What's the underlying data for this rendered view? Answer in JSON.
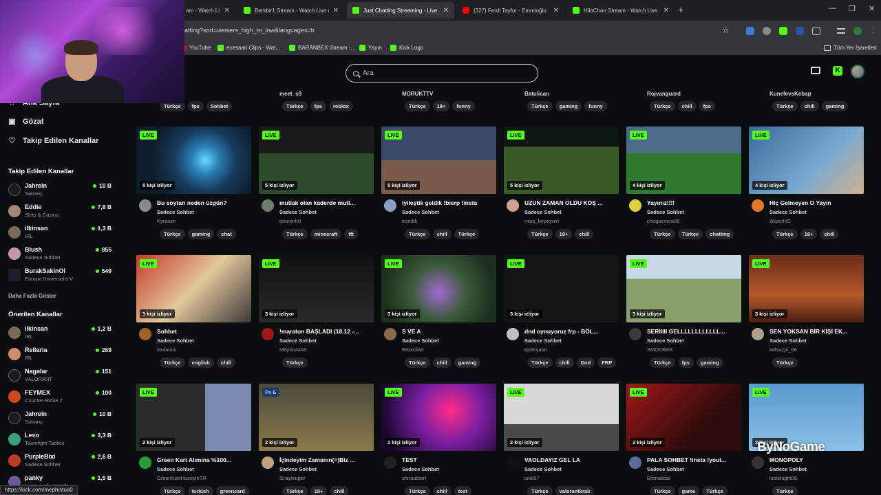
{
  "browser": {
    "tabs": [
      {
        "title": "am - Watch Li",
        "icon": "kick-favicon"
      },
      {
        "title": "Berkbir1 Stream - Watch Live o",
        "icon": "kick-favicon"
      },
      {
        "title": "Just Chatting Streaming - Live S",
        "icon": "kick-favicon",
        "active": true
      },
      {
        "title": "(327) Ferdi Tayfur - Emmioğlu",
        "icon": "youtube-favicon"
      },
      {
        "title": "HiloChan Stream - Watch Live o",
        "icon": "kick-favicon"
      }
    ],
    "url": "atting?sort=viewers_high_to_low&languages=tr",
    "bookmarks": [
      {
        "label": "YouTube",
        "icon": "youtube-icon"
      },
      {
        "label": "ecesaari Clips - Wat...",
        "icon": "kick-icon"
      },
      {
        "label": "BARANBEX Stream -...",
        "icon": "kick-icon"
      },
      {
        "label": "Yayın",
        "icon": "kick-icon"
      },
      {
        "label": "Kick Logo",
        "icon": "kick-icon"
      }
    ],
    "all_bookmarks": "Tüm Yer İşaretleri",
    "status_url": "https://kick.com/mephistoa0"
  },
  "header": {
    "search_placeholder": "Ara"
  },
  "sidebar": {
    "nav": [
      {
        "label": "Ana Sayfa",
        "icon": "home-icon"
      },
      {
        "label": "Gözat",
        "icon": "browse-icon"
      },
      {
        "label": "Takip Edilen Kanallar",
        "icon": "heart-icon"
      }
    ],
    "followed_title": "Takip Edilen Kanallar",
    "followed": [
      {
        "name": "Jahrein",
        "category": "Satranç",
        "viewers": "10 B"
      },
      {
        "name": "Eddie",
        "category": "Slots & Casino",
        "viewers": "7,8 B"
      },
      {
        "name": "ilkinsan",
        "category": "IRL",
        "viewers": "1,3 B"
      },
      {
        "name": "Blush",
        "category": "Sadece Sohbet",
        "viewers": "855"
      },
      {
        "name": "BurakSakinOl",
        "category": "Europa Universalis V",
        "viewers": "549"
      }
    ],
    "show_more": "Daha Fazla Göster",
    "recommended_title": "Önerilen Kanallar",
    "recommended": [
      {
        "name": "ilkinsan",
        "category": "IRL",
        "viewers": "1,2 B"
      },
      {
        "name": "Rellaria",
        "category": "IRL",
        "viewers": "269"
      },
      {
        "name": "Nagalar",
        "category": "VALORANT",
        "viewers": "151"
      },
      {
        "name": "FEYMEX",
        "category": "Counter-Strike 2",
        "viewers": "100"
      },
      {
        "name": "Jahrein",
        "category": "Satranç",
        "viewers": "10 B"
      },
      {
        "name": "Levo",
        "category": "Teamfight Tactics",
        "viewers": "3,3 B"
      },
      {
        "name": "PurpleBixi",
        "category": "Sadece Sohbet",
        "viewers": "2,6 B"
      },
      {
        "name": "panky",
        "category": "League of Legends",
        "viewers": "1,5 B"
      }
    ]
  },
  "top_row": [
    {
      "name": "s_ZONE",
      "tags": [
        "Türkçe",
        "fps",
        "Sohbet"
      ]
    },
    {
      "name": "meet_s9",
      "tags": [
        "Türkçe",
        "fps",
        "roblox"
      ]
    },
    {
      "name": "MORUKTTV",
      "tags": [
        "Türkçe",
        "18+",
        "funny"
      ]
    },
    {
      "name": "Batulican",
      "tags": [
        "Türkçe",
        "gaming",
        "funny"
      ]
    },
    {
      "name": "Rojvanguard",
      "tags": [
        "Türkçe",
        "chill",
        "fps"
      ]
    },
    {
      "name": "KunefevsKebap",
      "tags": [
        "Türkçe",
        "chill",
        "gaming"
      ]
    }
  ],
  "streams": [
    {
      "title": "Bu soytarı neden üzgün?",
      "category": "Sadece Sohbet",
      "channel": "Kyraaen",
      "viewers": "5 kişi izliyor",
      "live": "LIVE",
      "tags": [
        "Türkçe",
        "gaming",
        "chat"
      ],
      "thumb": "th-game1",
      "avatar": "#8a8a8a"
    },
    {
      "title": "mutlak olan kaderde mutl...",
      "category": "Sadece Sohbet",
      "channel": "omerinh0",
      "viewers": "5 kişi izliyor",
      "live": "LIVE",
      "tags": [
        "Türkçe",
        "minecraft",
        "tft"
      ],
      "thumb": "th-football",
      "avatar": "#6d7d6d"
    },
    {
      "title": "iyileştik geldik !bierp !insta",
      "category": "Sadece Sohbet",
      "channel": "irembk",
      "viewers": "5 kişi izliyor",
      "live": "LIVE",
      "tags": [
        "Türkçe",
        "chill",
        "Türkçe"
      ],
      "thumb": "th-girl",
      "avatar": "#8aa0c0"
    },
    {
      "title": "UZUN ZAMAN OLDU KOŞ ...",
      "category": "Sadece Sohbet",
      "channel": "miss_lorpeyniri",
      "viewers": "5 kişi izliyor",
      "live": "LIVE",
      "tags": [
        "Türkçe",
        "18+",
        "chill"
      ],
      "thumb": "th-field",
      "avatar": "#d0a090"
    },
    {
      "title": "Yayınız!!!!",
      "category": "Sadece Sohbet",
      "channel": "cheguevera35",
      "viewers": "4 kişi izliyor",
      "live": "LIVE",
      "tags": [
        "Türkçe",
        "Türkçe",
        "chatting"
      ],
      "thumb": "th-stadium",
      "avatar": "#e0d040"
    },
    {
      "title": "Hiç Gelmeyen O Yayın",
      "category": "Sadece Sohbet",
      "channel": "WiperHG",
      "viewers": "4 kişi izliyor",
      "live": "LIVE",
      "tags": [
        "Türkçe",
        "18+",
        "chill"
      ],
      "thumb": "th-man",
      "avatar": "#e07a2a"
    },
    {
      "title": "Sohbet",
      "category": "Sadece Sohbet",
      "channel": "xtufanus",
      "viewers": "3 kişi izliyor",
      "live": "LIVE",
      "tags": [
        "Türkçe",
        "english",
        "chill"
      ],
      "thumb": "th-chat",
      "avatar": "#a0602a"
    },
    {
      "title": "!maraton BAŞLADI (18.12 -...",
      "category": "Sadece Sohbet",
      "channel": "MephistoA0",
      "viewers": "3 kişi izliyor",
      "live": "LIVE",
      "tags": [
        "Türkçe"
      ],
      "thumb": "th-dark",
      "avatar": "#a01818"
    },
    {
      "title": "S VE A",
      "category": "Sadece Sohbet",
      "channel": "Eexodiaa",
      "viewers": "3 kişi izliyor",
      "live": "LIVE",
      "tags": [
        "Türkçe",
        "chill",
        "gaming"
      ],
      "thumb": "th-lol",
      "avatar": "#8a6a4a"
    },
    {
      "title": "dnd oynuyoruz frp - BÖL...",
      "category": "Sadece Sohbet",
      "channel": "ejderyalar",
      "viewers": "3 kişi izliyor",
      "live": "LIVE",
      "tags": [
        "Türkçe",
        "chill",
        "Dnd",
        "FRP"
      ],
      "thumb": "th-desk",
      "avatar": "#c0c0c0"
    },
    {
      "title": "SERIIIII GELLLLLLLLLLLL...",
      "category": "Sadece Sohbet",
      "channel": "SMOOKKK",
      "viewers": "3 kişi izliyor",
      "live": "LIVE",
      "tags": [
        "Türkçe",
        "fps",
        "gaming"
      ],
      "thumb": "th-road",
      "avatar": "#3a3a3a"
    },
    {
      "title": "SEN YOKSAN BİR KİŞİ EK...",
      "category": "Sadece Sohbet",
      "channel": "kolsuzpi_06",
      "viewers": "3 kişi izliyor",
      "live": "LIVE",
      "tags": [
        "Türkçe"
      ],
      "thumb": "th-desert",
      "avatar": "#b0a090"
    },
    {
      "title": "Green Kart Alımına %100...",
      "category": "Sadece Sohbet",
      "channel": "GreenKartHuseyinTR",
      "viewers": "2 kişi izliyor",
      "live": "LIVE",
      "tags": [
        "Türkçe",
        "turkish",
        "greencard"
      ],
      "thumb": "th-usa",
      "avatar": "#2a9a3a"
    },
    {
      "title": "İçindeyim Zamanın(=)Biz ...",
      "category": "Sadece Sohbet",
      "channel": "Graykruger",
      "viewers": "2 kişi izliyor",
      "live": "",
      "tags": [
        "Türkçe",
        "18+",
        "chill"
      ],
      "thumb": "th-ps",
      "avatar": "#c0a080"
    },
    {
      "title": "TEST",
      "category": "Sadece Sohbet",
      "channel": "shroudcan",
      "viewers": "2 kişi izliyor",
      "live": "LIVE",
      "tags": [
        "Türkçe",
        "chill",
        "test"
      ],
      "thumb": "th-neon",
      "avatar": "#222"
    },
    {
      "title": "VAOLDAYIZ GEL LA",
      "category": "Sadece Sohbet",
      "channel": "isok07",
      "viewers": "2 kişi izliyor",
      "live": "LIVE",
      "tags": [
        "Türkçe",
        "valorantkralı"
      ],
      "thumb": "th-screen",
      "avatar": "#111"
    },
    {
      "title": "PALA SOHBET !insta !yout...",
      "category": "Sadece Sohbet",
      "channel": "Erenakbal",
      "viewers": "2 kişi izliyor",
      "live": "LIVE",
      "tags": [
        "Türkçe",
        "game",
        "Türkçe"
      ],
      "thumb": "th-red",
      "avatar": "#5a6a9a"
    },
    {
      "title": "MONOPOLY",
      "category": "Sadece Sohbet",
      "channel": "lostknight06",
      "viewers": "2 kişi izliyor",
      "live": "LIVE",
      "tags": [
        "Türkçe"
      ],
      "thumb": "th-mono",
      "avatar": "#333"
    }
  ],
  "ps_badge": "Ps E",
  "watermark": "ByNoGame"
}
